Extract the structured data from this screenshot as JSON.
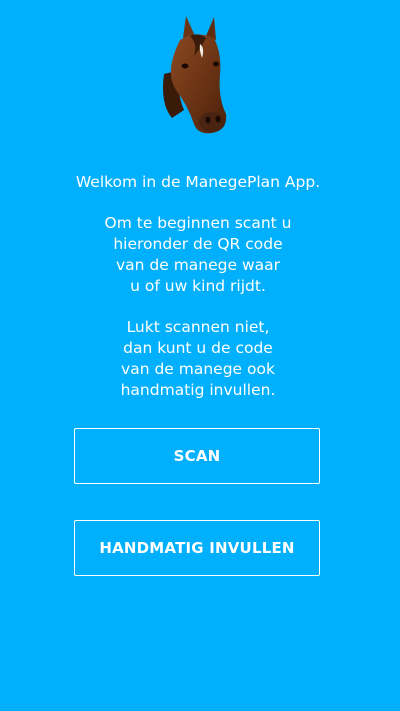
{
  "logo": {
    "icon": "horse-head-icon"
  },
  "welcome": "Welkom in de ManegePlan App.",
  "instructions": [
    "Om te beginnen scant u",
    "hieronder de QR code",
    "van de manege waar",
    "u of uw kind rijdt."
  ],
  "fallback": [
    "Lukt scannen niet,",
    "dan kunt u de code",
    "van de manege ook",
    "handmatig invullen."
  ],
  "buttons": {
    "scan": "SCAN",
    "manual": "HANDMATIG INVULLEN"
  },
  "colors": {
    "background": "#00b0fd",
    "text": "#ffffff"
  }
}
